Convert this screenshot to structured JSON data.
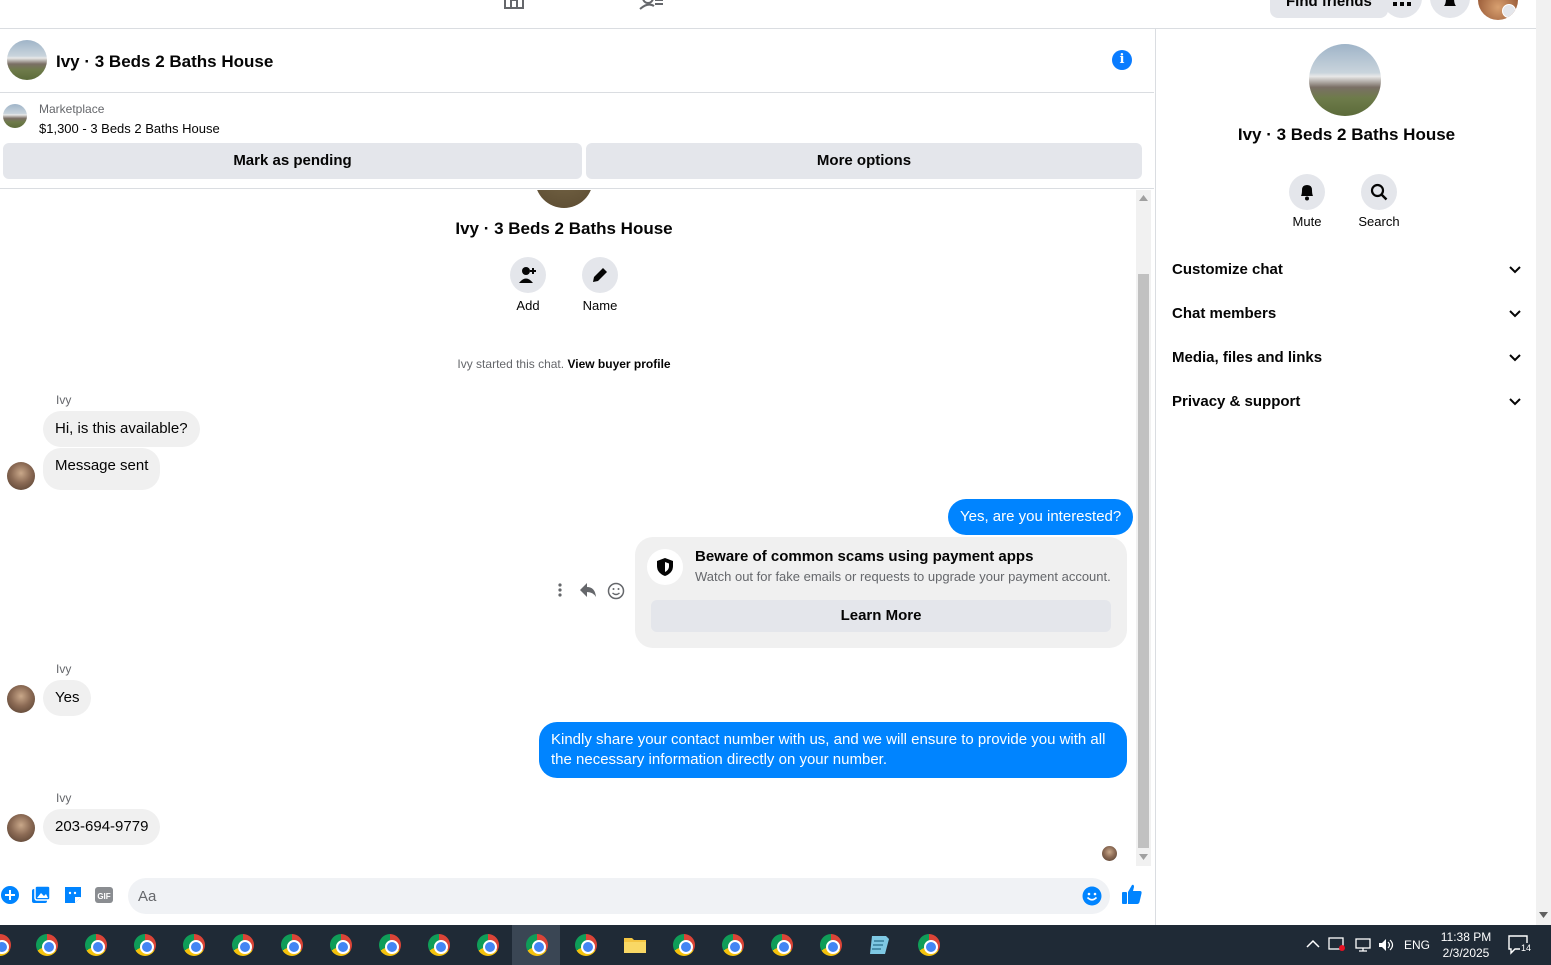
{
  "topbar": {
    "find_friends": "Find friends"
  },
  "chat_header": {
    "title": "Ivy · 3 Beds 2 Baths House"
  },
  "marketplace": {
    "label": "Marketplace",
    "listing": "$1,300 - 3 Beds 2 Baths House",
    "mark_pending": "Mark as pending",
    "more_options": "More options"
  },
  "chat": {
    "name": "Ivy · 3 Beds 2 Baths House",
    "actions": [
      {
        "label": "Add",
        "icon": "add-person-icon"
      },
      {
        "label": "Name",
        "icon": "pencil-icon"
      }
    ],
    "started_text": "Ivy started this chat.",
    "view_profile": "View buyer profile",
    "messages": [
      {
        "sender": "Ivy",
        "text": "Hi, is this available?"
      },
      {
        "text": "Message sent"
      },
      {
        "me": true,
        "text": "Yes, are you interested?"
      },
      {
        "sender": "Ivy",
        "text": "Yes"
      },
      {
        "me": true,
        "text": "Kindly share your contact number with us, and we will ensure to provide you with all the necessary information directly on your number."
      },
      {
        "sender": "Ivy",
        "text": "203-694-9779"
      }
    ],
    "scam_card": {
      "title": "Beware of common scams using payment apps",
      "subtitle": "Watch out for fake emails or requests to upgrade your payment account.",
      "button": "Learn More"
    }
  },
  "composer": {
    "placeholder": "Aa"
  },
  "right_panel": {
    "name": "Ivy · 3 Beds 2 Baths House",
    "mute": "Mute",
    "search": "Search",
    "sections": [
      "Customize chat",
      "Chat members",
      "Media, files and links",
      "Privacy & support"
    ]
  },
  "taskbar": {
    "language": "ENG",
    "time": "11:38 PM",
    "date": "2/3/2025",
    "notification_count": "14"
  },
  "colors": {
    "accent": "#0084ff",
    "bubble_in": "#f0f0f0",
    "button_gray": "#e4e6eb"
  }
}
